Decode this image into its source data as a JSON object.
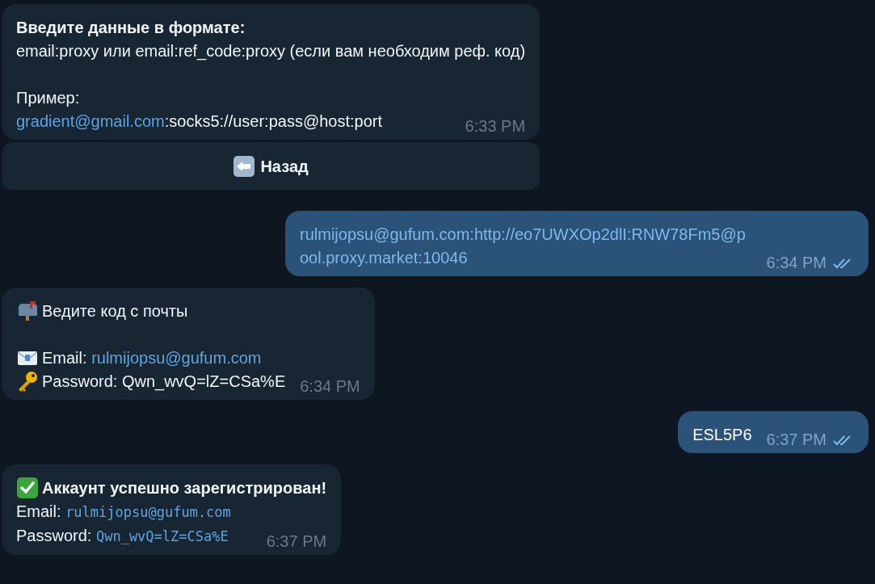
{
  "messages": [
    {
      "kind": "incoming",
      "time": "6:33 PM",
      "lines": [
        {
          "kind": "plain",
          "bold": true,
          "segments": [
            {
              "kind": "text",
              "text": "Введите данные в формате:"
            }
          ]
        },
        {
          "kind": "plain",
          "bold": false,
          "segments": [
            {
              "kind": "text",
              "text": "email:proxy или email:ref_code:proxy (если вам необходим реф. код)"
            }
          ]
        },
        {
          "kind": "blank"
        },
        {
          "kind": "plain",
          "bold": false,
          "segments": [
            {
              "kind": "text",
              "text": "Пример:"
            }
          ]
        },
        {
          "kind": "plain",
          "bold": false,
          "segments": [
            {
              "kind": "link",
              "text": "gradient@gmail.com"
            },
            {
              "kind": "text",
              "text": ":socks5://user:pass@host:port"
            }
          ]
        }
      ],
      "buttons": [
        {
          "label": "Назад"
        }
      ]
    },
    {
      "kind": "outgoing",
      "time": "6:34 PM",
      "read": true,
      "lines": [
        {
          "kind": "plain",
          "bold": false,
          "segments": [
            {
              "kind": "link",
              "text": "rulmijopsu@gufum.com:http://eo7UWXOp2dlI:RNW78Fm5@pool.proxy.market:10046"
            }
          ]
        }
      ]
    },
    {
      "kind": "incoming",
      "time": "6:34 PM",
      "lines": [
        {
          "kind": "notice",
          "bold": false,
          "segments": [
            {
              "kind": "text",
              "text": "Ведите код с почты"
            }
          ]
        },
        {
          "kind": "blank"
        },
        {
          "kind": "email",
          "bold": false,
          "segments": [
            {
              "kind": "text",
              "text": "Email: "
            },
            {
              "kind": "link",
              "text": "rulmijopsu@gufum.com"
            }
          ]
        },
        {
          "kind": "password",
          "bold": false,
          "segments": [
            {
              "kind": "text",
              "text": "Password: Qwn_wvQ=lZ=CSa%E"
            }
          ]
        }
      ]
    },
    {
      "kind": "outgoing",
      "time": "6:37 PM",
      "read": true,
      "lines": [
        {
          "kind": "plain",
          "bold": false,
          "segments": [
            {
              "kind": "text",
              "text": "ESL5P6"
            }
          ]
        }
      ]
    },
    {
      "kind": "incoming",
      "time": "6:37 PM",
      "lines": [
        {
          "kind": "success",
          "bold": true,
          "segments": [
            {
              "kind": "text",
              "text": "Аккаунт успешно зарегистрирован!"
            }
          ]
        },
        {
          "kind": "plain",
          "bold": false,
          "segments": [
            {
              "kind": "text",
              "text": "Email: "
            },
            {
              "kind": "code",
              "text": "rulmijopsu@gufum.com"
            }
          ]
        },
        {
          "kind": "plain",
          "bold": false,
          "segments": [
            {
              "kind": "text",
              "text": "Password: "
            },
            {
              "kind": "code",
              "text": "Qwn_wvQ=lZ=CSa%E"
            }
          ]
        }
      ]
    }
  ]
}
